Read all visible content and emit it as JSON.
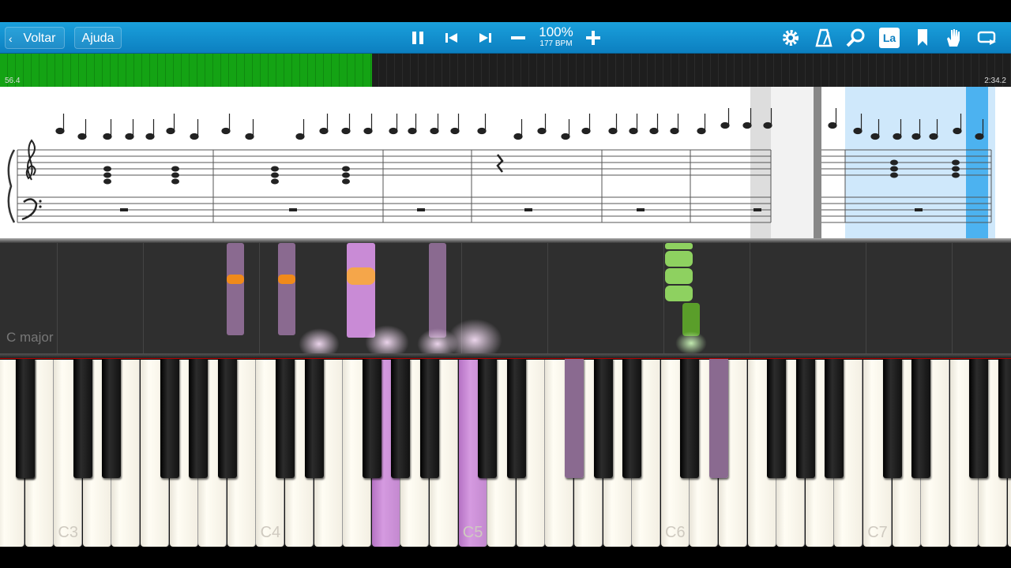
{
  "toolbar": {
    "back_label": "Voltar",
    "help_label": "Ajuda",
    "tempo_percent": "100%",
    "tempo_bpm": "177 BPM",
    "icons": [
      "pause-icon",
      "previous-icon",
      "next-icon",
      "minus-icon",
      "plus-icon",
      "gear-icon",
      "metronome-icon",
      "search-icon",
      "note-label-icon",
      "bookmark-icon",
      "hand-icon",
      "loop-icon"
    ],
    "note_label_text": "La"
  },
  "progress": {
    "elapsed": "56.4",
    "total": "2:34.2",
    "fraction": 0.368
  },
  "roll": {
    "key_signature": "C major"
  },
  "keyboard": {
    "octave_labels": [
      "C3",
      "C4",
      "C5",
      "C6",
      "C7"
    ]
  },
  "colors": {
    "toolbar": "#0c7fc0",
    "progress": "#14a314",
    "left_hand": "#c98bd6",
    "right_hand": "#6fbf3a",
    "highlight": "#f08a1a"
  }
}
